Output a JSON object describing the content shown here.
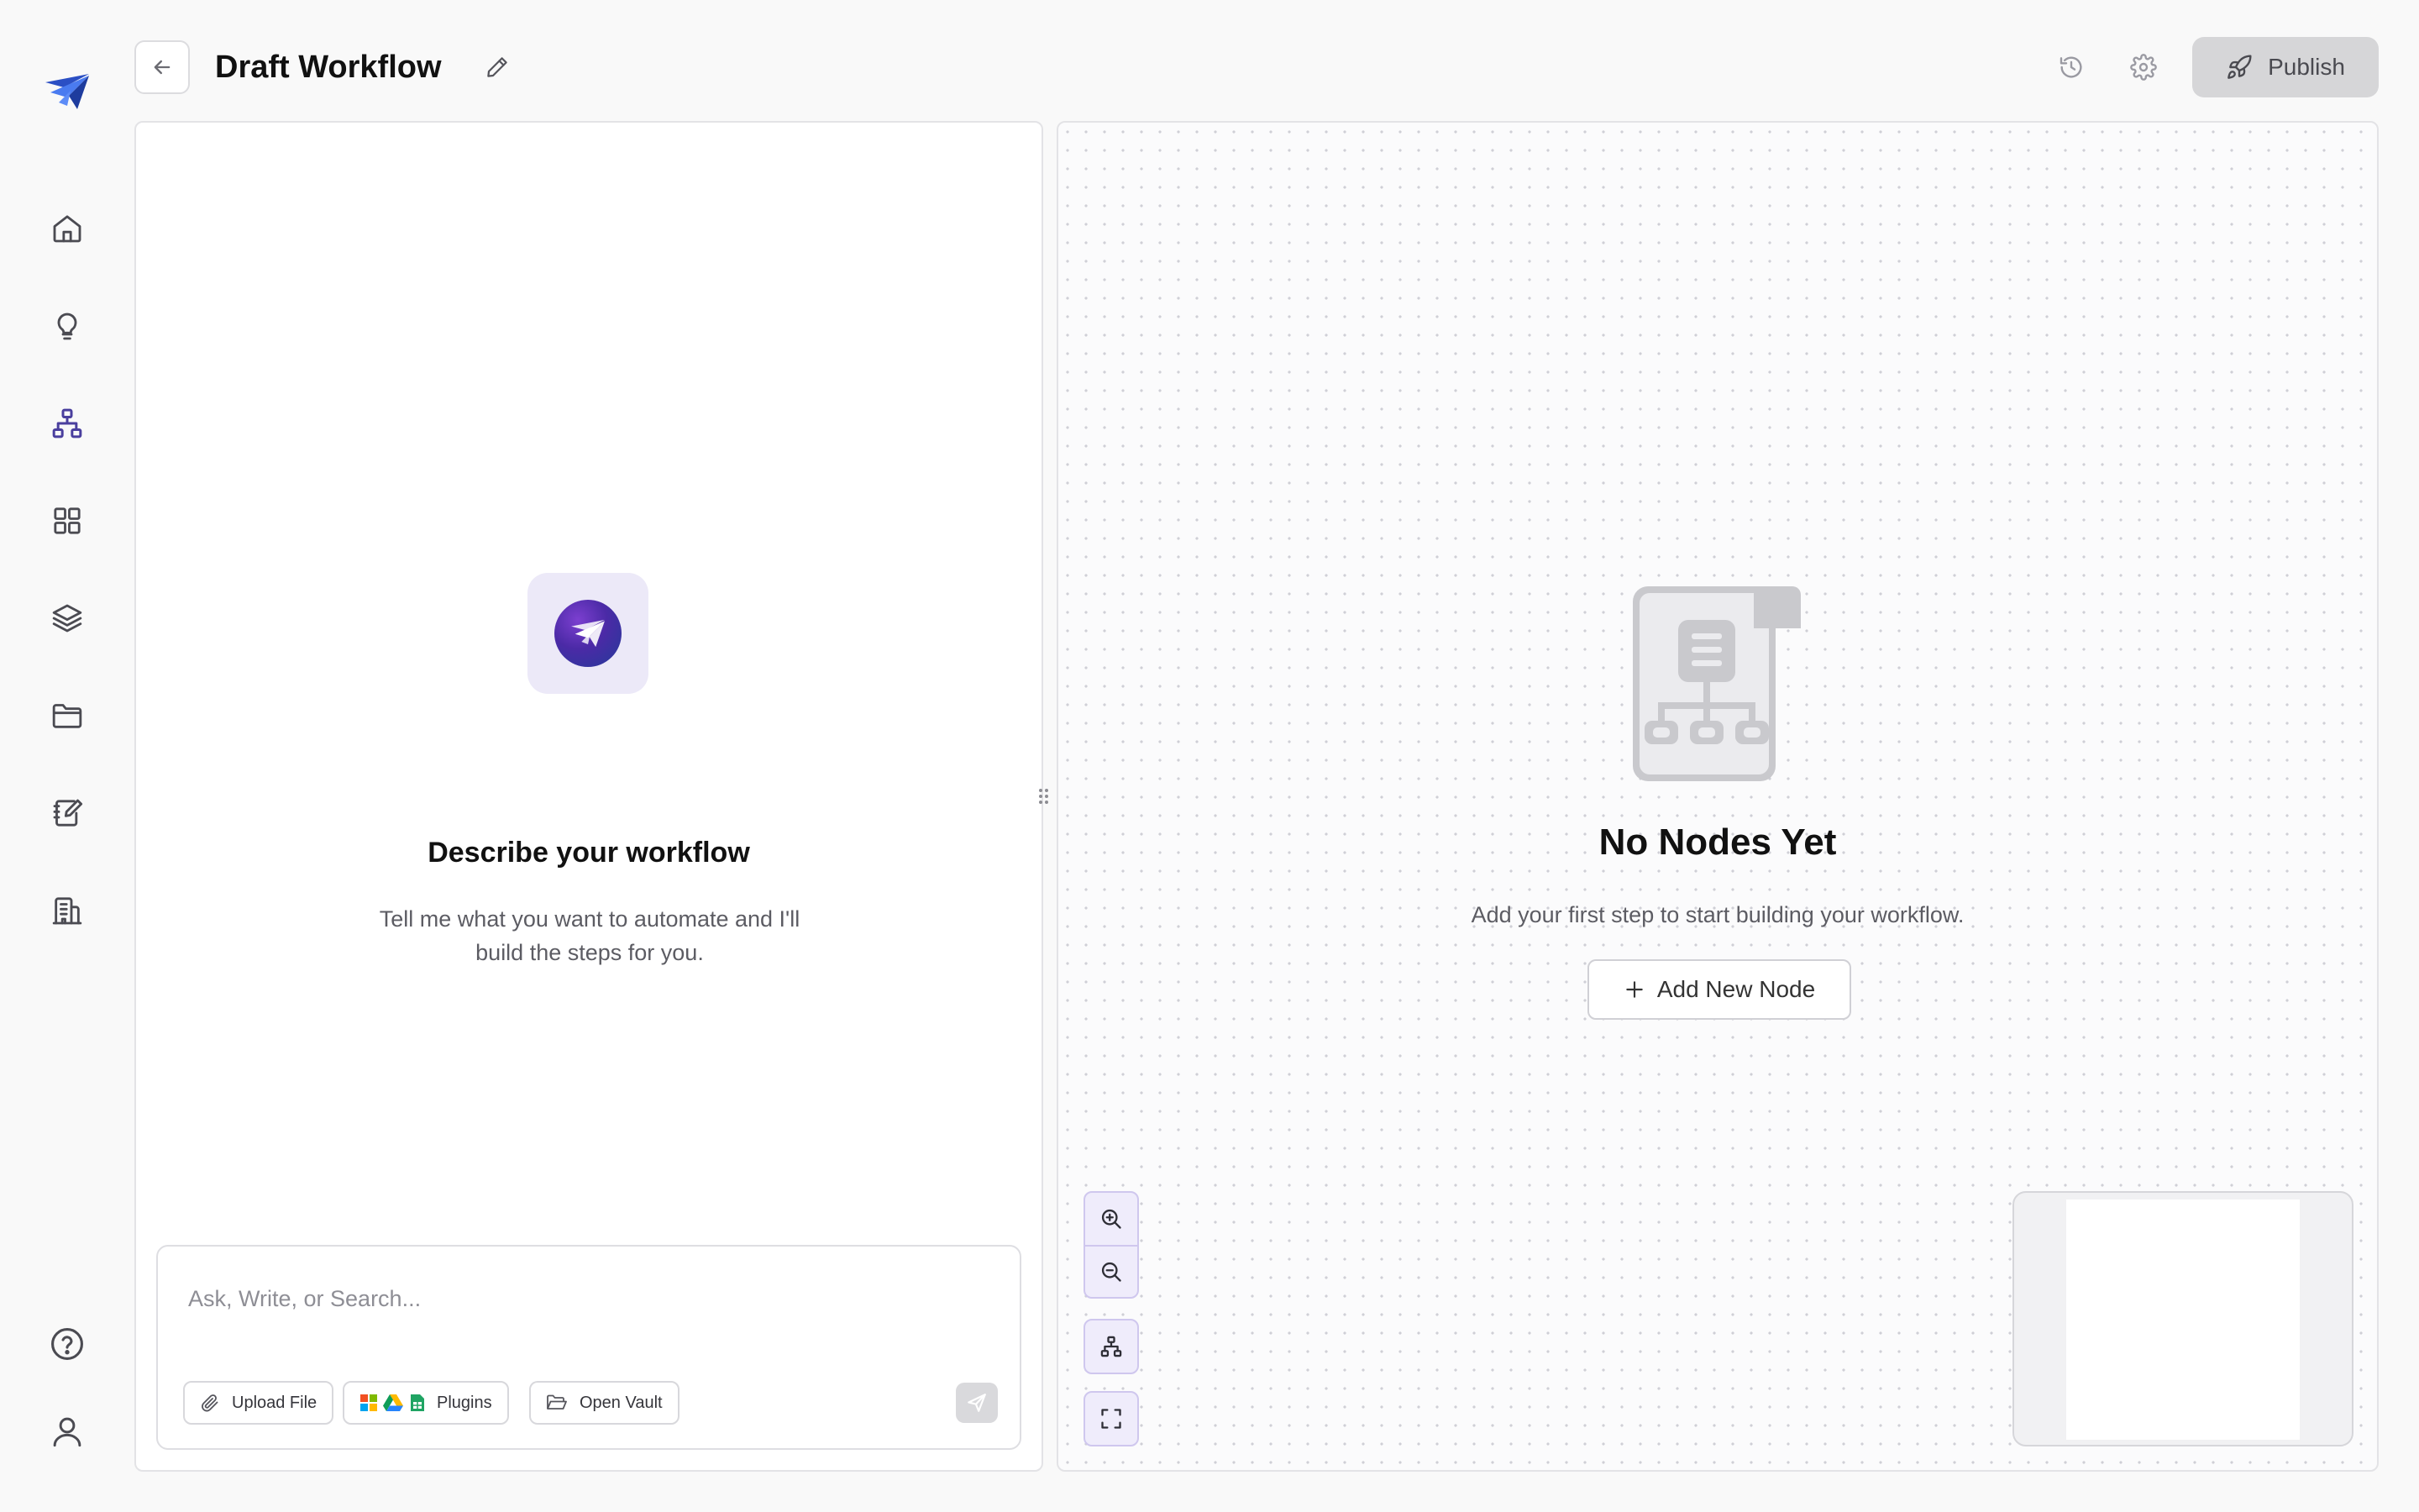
{
  "header": {
    "title": "Draft Workflow",
    "publish_label": "Publish"
  },
  "sidebar": {
    "items": [
      {
        "icon": "home-icon",
        "active": false
      },
      {
        "icon": "lightbulb-icon",
        "active": false
      },
      {
        "icon": "workflow-icon",
        "active": true
      },
      {
        "icon": "grid-icon",
        "active": false
      },
      {
        "icon": "layers-icon",
        "active": false
      },
      {
        "icon": "folder-icon",
        "active": false
      },
      {
        "icon": "notebook-edit-icon",
        "active": false
      },
      {
        "icon": "building-icon",
        "active": false
      }
    ],
    "bottom_items": [
      {
        "icon": "help-icon"
      },
      {
        "icon": "user-icon"
      }
    ]
  },
  "chat": {
    "heading": "Describe your workflow",
    "subtext": "Tell me what you want to automate and I'll build the steps for you.",
    "input_placeholder": "Ask, Write, or Search...",
    "input_value": "",
    "chips": {
      "upload": "Upload File",
      "plugins": "Plugins",
      "vault": "Open Vault"
    }
  },
  "canvas": {
    "empty_title": "No Nodes Yet",
    "empty_subtitle": "Add your first step to start building your workflow.",
    "add_node_label": "Add New Node"
  },
  "colors": {
    "accent": "#4a3f9e",
    "publish_bg": "#d6d6d8",
    "canvas_control_bg": "#efecfb",
    "canvas_control_border": "#cfc7ee"
  }
}
